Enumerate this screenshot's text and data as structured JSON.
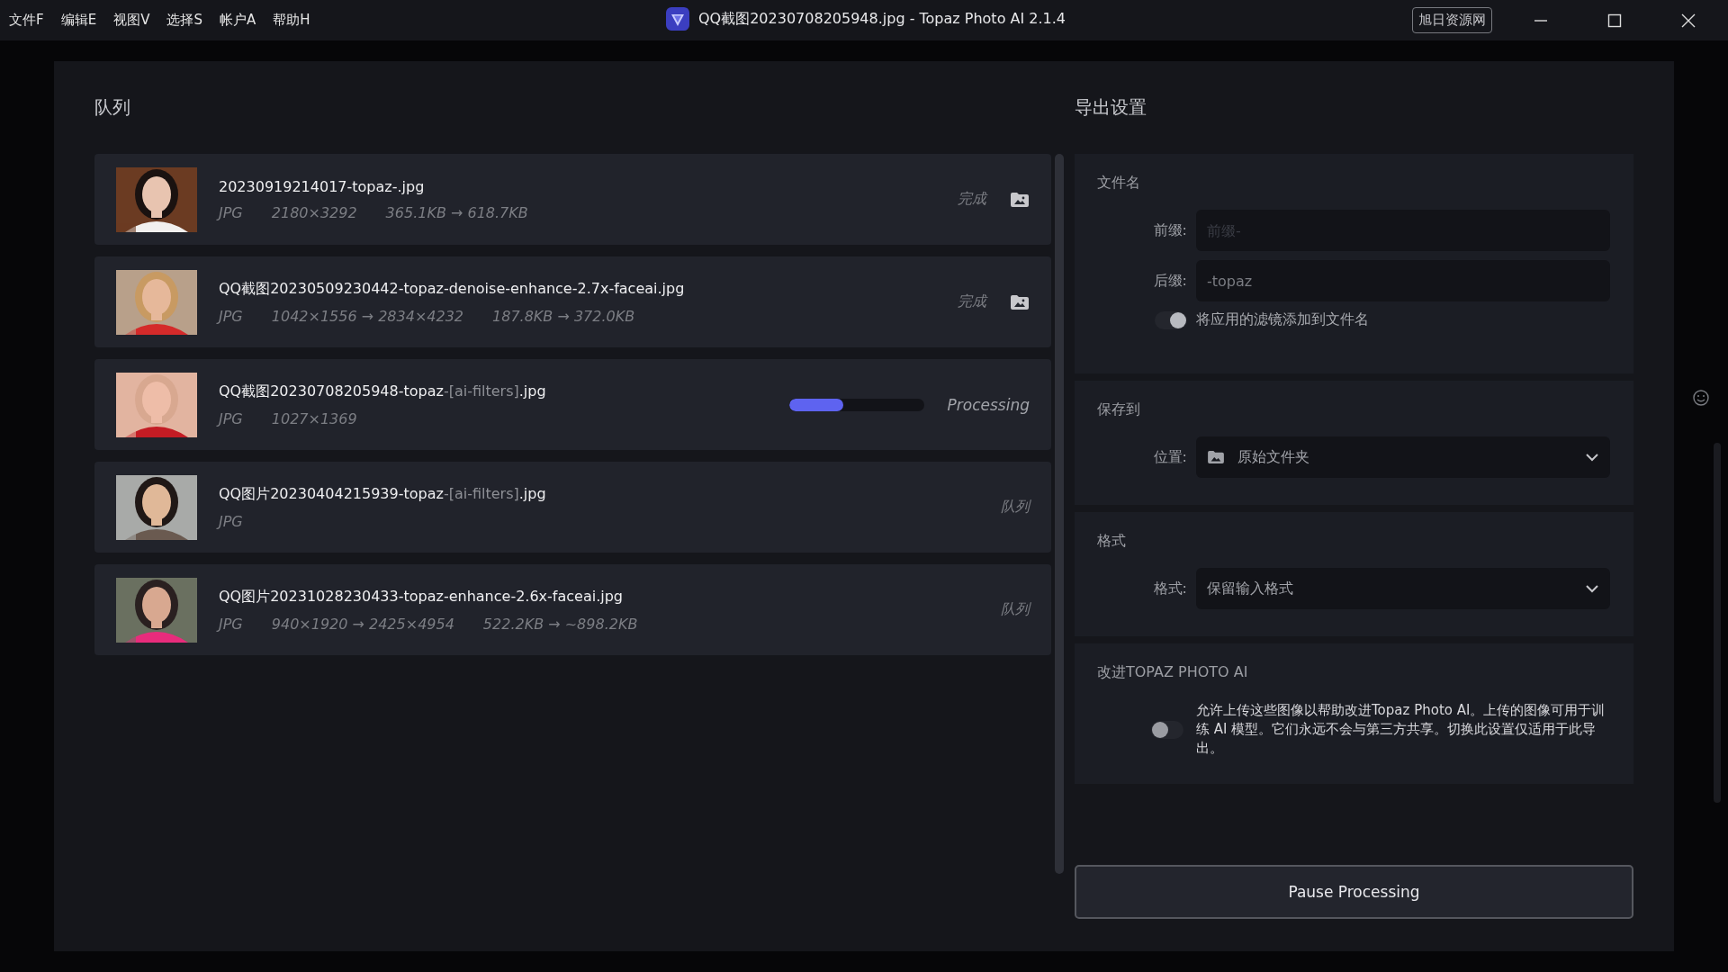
{
  "menu": [
    {
      "label": "文件F"
    },
    {
      "label": "编辑E"
    },
    {
      "label": "视图V"
    },
    {
      "label": "选择S"
    },
    {
      "label": "帐户A"
    },
    {
      "label": "帮助H"
    }
  ],
  "window": {
    "title": "QQ截图20230708205948.jpg - Topaz Photo AI 2.1.4",
    "badge": "旭日资源网"
  },
  "queue": {
    "title": "队列",
    "items": [
      {
        "name_start": "20230919214017-topaz-.jpg",
        "meta": [
          "JPG",
          "2180×3292",
          "365.1KB → 618.7KB"
        ],
        "kind": "done",
        "status": "完成"
      },
      {
        "name_start": "QQ截图20230509230442-topaz-denoise-enhance-2.7x-faceai.jpg",
        "meta": [
          "JPG",
          "1042×1556 → 2834×4232",
          "187.8KB → 372.0KB"
        ],
        "kind": "done",
        "status": "完成"
      },
      {
        "name_start": "QQ截图20230708205948-topaz",
        "name_tag": "-[ai-filters]",
        "name_end": ".jpg",
        "meta": [
          "JPG",
          "1027×1369"
        ],
        "kind": "processing",
        "status": "Processing",
        "level": 0.4
      },
      {
        "name_start": "QQ图片20230404215939-topaz",
        "name_tag": "-[ai-filters]",
        "name_end": ".jpg",
        "meta": [
          "JPG"
        ],
        "kind": "queued",
        "status": "队列"
      },
      {
        "name_start": "QQ图片20231028230433-topaz-enhance-2.6x-faceai.jpg",
        "meta": [
          "JPG",
          "940×1920 → 2425×4954",
          "522.2KB → ~898.2KB"
        ],
        "kind": "queued",
        "status": "队列"
      }
    ]
  },
  "export": {
    "title": "导出设置",
    "filename": {
      "title": "文件名",
      "prefix_label": "前缀:",
      "prefix_placeholder": "前缀-",
      "suffix_label": "后缀:",
      "suffix_value": "-topaz",
      "toggle_label": "将应用的滤镜添加到文件名",
      "toggle_on": true
    },
    "save_to": {
      "title": "保存到",
      "label": "位置:",
      "value": "原始文件夹"
    },
    "format": {
      "title": "格式",
      "label": "格式:",
      "value": "保留输入格式"
    },
    "improve": {
      "title": "改进TOPAZ PHOTO AI",
      "text": "允许上传这些图像以帮助改进Topaz Photo AI。上传的图像可用于训练 AI 模型。它们永远不会与第三方共享。切换此设置仅适用于此导出。",
      "toggle_on": false
    }
  },
  "pause_button": "Pause Processing"
}
